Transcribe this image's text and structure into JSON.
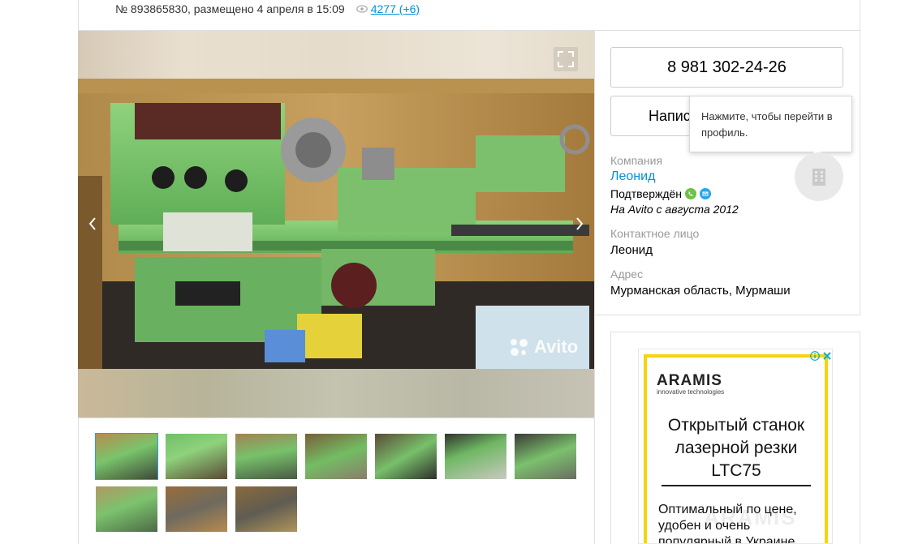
{
  "listing": {
    "meta": "№ 893865830, размещено 4 апреля в 15:09",
    "views": "4277 (+6)"
  },
  "gallery": {
    "watermark": "Avito",
    "thumbnail_count": 10
  },
  "contact": {
    "phone": "8 981 302-24-26",
    "write_label": "Написать сообщение",
    "tooltip": "Нажмите, чтобы перейти в профиль.",
    "company_label": "Компания",
    "company_name": "Леонид",
    "confirmed": "Подтверждён",
    "since": "На Avito с августа 2012",
    "contact_label": "Контактное лицо",
    "contact_name": "Леонид",
    "address_label": "Адрес",
    "address": "Мурманская область, Мурмаши"
  },
  "ad": {
    "brand": "ARAMIS",
    "tagline": "innovative technologies",
    "headline": "Открытый станок лазерной резки LTC75",
    "body": "Оптимальный по цене, удобен и очень популярный в Украине",
    "ghost": "ARAMIS"
  },
  "colors": {
    "link": "#0091d9",
    "active_thumb": "#2a9fe8",
    "ad_accent": "#f5d40f"
  }
}
